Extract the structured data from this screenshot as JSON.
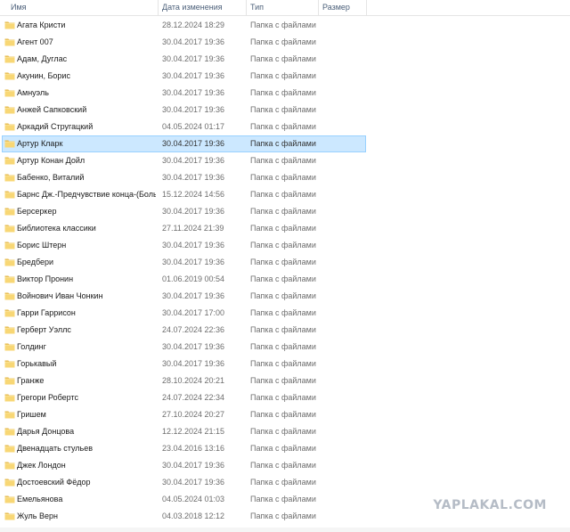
{
  "columns": {
    "name": "Имя",
    "date": "Дата изменения",
    "type": "Тип",
    "size": "Размер"
  },
  "files": [
    {
      "name": "Агата Кристи",
      "date": "28.12.2024 18:29",
      "type": "Папка с файлами",
      "size": ""
    },
    {
      "name": "Агент 007",
      "date": "30.04.2017 19:36",
      "type": "Папка с файлами",
      "size": ""
    },
    {
      "name": "Адам, Дуглас",
      "date": "30.04.2017 19:36",
      "type": "Папка с файлами",
      "size": ""
    },
    {
      "name": "Акунин, Борис",
      "date": "30.04.2017 19:36",
      "type": "Папка с файлами",
      "size": ""
    },
    {
      "name": "Амнуэль",
      "date": "30.04.2017 19:36",
      "type": "Папка с файлами",
      "size": ""
    },
    {
      "name": "Анжей Сапковский",
      "date": "30.04.2017 19:36",
      "type": "Папка с файлами",
      "size": ""
    },
    {
      "name": "Аркадий Стругацкий",
      "date": "04.05.2024 01:17",
      "type": "Папка с файлами",
      "size": ""
    },
    {
      "name": "Артур Кларк",
      "date": "30.04.2017 19:36",
      "type": "Папка с файлами",
      "size": "",
      "selected": true
    },
    {
      "name": "Артур Конан Дойл",
      "date": "30.04.2017 19:36",
      "type": "Папка с файлами",
      "size": ""
    },
    {
      "name": "Бабенко, Виталий",
      "date": "30.04.2017 19:36",
      "type": "Папка с файлами",
      "size": ""
    },
    {
      "name": "Барнс Дж.-Предчувствие конца-(Боль...",
      "date": "15.12.2024 14:56",
      "type": "Папка с файлами",
      "size": ""
    },
    {
      "name": "Берсеркер",
      "date": "30.04.2017 19:36",
      "type": "Папка с файлами",
      "size": ""
    },
    {
      "name": "Библиотека классики",
      "date": "27.11.2024 21:39",
      "type": "Папка с файлами",
      "size": ""
    },
    {
      "name": "Борис Штерн",
      "date": "30.04.2017 19:36",
      "type": "Папка с файлами",
      "size": ""
    },
    {
      "name": "Бредбери",
      "date": "30.04.2017 19:36",
      "type": "Папка с файлами",
      "size": ""
    },
    {
      "name": "Виктор Пронин",
      "date": "01.06.2019 00:54",
      "type": "Папка с файлами",
      "size": ""
    },
    {
      "name": "Войнович Иван Чонкин",
      "date": "30.04.2017 19:36",
      "type": "Папка с файлами",
      "size": ""
    },
    {
      "name": "Гарри Гаррисон",
      "date": "30.04.2017 17:00",
      "type": "Папка с файлами",
      "size": ""
    },
    {
      "name": "Герберт Уэллс",
      "date": "24.07.2024 22:36",
      "type": "Папка с файлами",
      "size": ""
    },
    {
      "name": "Голдинг",
      "date": "30.04.2017 19:36",
      "type": "Папка с файлами",
      "size": ""
    },
    {
      "name": "Горькавый",
      "date": "30.04.2017 19:36",
      "type": "Папка с файлами",
      "size": ""
    },
    {
      "name": "Гранже",
      "date": "28.10.2024 20:21",
      "type": "Папка с файлами",
      "size": ""
    },
    {
      "name": "Грегори Робертс",
      "date": "24.07.2024 22:34",
      "type": "Папка с файлами",
      "size": ""
    },
    {
      "name": "Гришем",
      "date": "27.10.2024 20:27",
      "type": "Папка с файлами",
      "size": ""
    },
    {
      "name": "Дарья Донцова",
      "date": "12.12.2024 21:15",
      "type": "Папка с файлами",
      "size": ""
    },
    {
      "name": "Двенадцать стульев",
      "date": "23.04.2016 13:16",
      "type": "Папка с файлами",
      "size": ""
    },
    {
      "name": "Джек Лондон",
      "date": "30.04.2017 19:36",
      "type": "Папка с файлами",
      "size": ""
    },
    {
      "name": "Достоевский Фёдор",
      "date": "30.04.2017 19:36",
      "type": "Папка с файлами",
      "size": ""
    },
    {
      "name": "Емельянова",
      "date": "04.05.2024 01:03",
      "type": "Папка с файлами",
      "size": ""
    },
    {
      "name": "Жуль Верн",
      "date": "04.03.2018 12:12",
      "type": "Папка с файлами",
      "size": ""
    }
  ],
  "watermark": "YAPLAKAL.COM",
  "icon": "folder-icon",
  "colors": {
    "folder": "#f8d775",
    "selection": "#cce8ff",
    "selection_border": "#99d1ff"
  }
}
